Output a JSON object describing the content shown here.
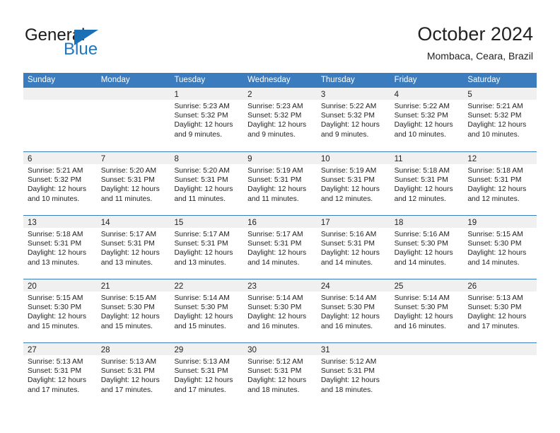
{
  "brand": {
    "name_part1": "General",
    "name_part2": "Blue",
    "accent_color": "#2077c0",
    "triangle_color": "#1a6fb5"
  },
  "header": {
    "title": "October 2024",
    "subtitle": "Mombaca, Ceara, Brazil"
  },
  "calendar": {
    "header_bg": "#3a7cbe",
    "day_band_bg": "#f0f0f0",
    "weekdays": [
      "Sunday",
      "Monday",
      "Tuesday",
      "Wednesday",
      "Thursday",
      "Friday",
      "Saturday"
    ],
    "weeks": [
      [
        {
          "day": "",
          "lines": []
        },
        {
          "day": "",
          "lines": []
        },
        {
          "day": "1",
          "lines": [
            "Sunrise: 5:23 AM",
            "Sunset: 5:32 PM",
            "Daylight: 12 hours and 9 minutes."
          ]
        },
        {
          "day": "2",
          "lines": [
            "Sunrise: 5:23 AM",
            "Sunset: 5:32 PM",
            "Daylight: 12 hours and 9 minutes."
          ]
        },
        {
          "day": "3",
          "lines": [
            "Sunrise: 5:22 AM",
            "Sunset: 5:32 PM",
            "Daylight: 12 hours and 9 minutes."
          ]
        },
        {
          "day": "4",
          "lines": [
            "Sunrise: 5:22 AM",
            "Sunset: 5:32 PM",
            "Daylight: 12 hours and 10 minutes."
          ]
        },
        {
          "day": "5",
          "lines": [
            "Sunrise: 5:21 AM",
            "Sunset: 5:32 PM",
            "Daylight: 12 hours and 10 minutes."
          ]
        }
      ],
      [
        {
          "day": "6",
          "lines": [
            "Sunrise: 5:21 AM",
            "Sunset: 5:32 PM",
            "Daylight: 12 hours and 10 minutes."
          ]
        },
        {
          "day": "7",
          "lines": [
            "Sunrise: 5:20 AM",
            "Sunset: 5:31 PM",
            "Daylight: 12 hours and 11 minutes."
          ]
        },
        {
          "day": "8",
          "lines": [
            "Sunrise: 5:20 AM",
            "Sunset: 5:31 PM",
            "Daylight: 12 hours and 11 minutes."
          ]
        },
        {
          "day": "9",
          "lines": [
            "Sunrise: 5:19 AM",
            "Sunset: 5:31 PM",
            "Daylight: 12 hours and 11 minutes."
          ]
        },
        {
          "day": "10",
          "lines": [
            "Sunrise: 5:19 AM",
            "Sunset: 5:31 PM",
            "Daylight: 12 hours and 12 minutes."
          ]
        },
        {
          "day": "11",
          "lines": [
            "Sunrise: 5:18 AM",
            "Sunset: 5:31 PM",
            "Daylight: 12 hours and 12 minutes."
          ]
        },
        {
          "day": "12",
          "lines": [
            "Sunrise: 5:18 AM",
            "Sunset: 5:31 PM",
            "Daylight: 12 hours and 12 minutes."
          ]
        }
      ],
      [
        {
          "day": "13",
          "lines": [
            "Sunrise: 5:18 AM",
            "Sunset: 5:31 PM",
            "Daylight: 12 hours and 13 minutes."
          ]
        },
        {
          "day": "14",
          "lines": [
            "Sunrise: 5:17 AM",
            "Sunset: 5:31 PM",
            "Daylight: 12 hours and 13 minutes."
          ]
        },
        {
          "day": "15",
          "lines": [
            "Sunrise: 5:17 AM",
            "Sunset: 5:31 PM",
            "Daylight: 12 hours and 13 minutes."
          ]
        },
        {
          "day": "16",
          "lines": [
            "Sunrise: 5:17 AM",
            "Sunset: 5:31 PM",
            "Daylight: 12 hours and 14 minutes."
          ]
        },
        {
          "day": "17",
          "lines": [
            "Sunrise: 5:16 AM",
            "Sunset: 5:31 PM",
            "Daylight: 12 hours and 14 minutes."
          ]
        },
        {
          "day": "18",
          "lines": [
            "Sunrise: 5:16 AM",
            "Sunset: 5:30 PM",
            "Daylight: 12 hours and 14 minutes."
          ]
        },
        {
          "day": "19",
          "lines": [
            "Sunrise: 5:15 AM",
            "Sunset: 5:30 PM",
            "Daylight: 12 hours and 14 minutes."
          ]
        }
      ],
      [
        {
          "day": "20",
          "lines": [
            "Sunrise: 5:15 AM",
            "Sunset: 5:30 PM",
            "Daylight: 12 hours and 15 minutes."
          ]
        },
        {
          "day": "21",
          "lines": [
            "Sunrise: 5:15 AM",
            "Sunset: 5:30 PM",
            "Daylight: 12 hours and 15 minutes."
          ]
        },
        {
          "day": "22",
          "lines": [
            "Sunrise: 5:14 AM",
            "Sunset: 5:30 PM",
            "Daylight: 12 hours and 15 minutes."
          ]
        },
        {
          "day": "23",
          "lines": [
            "Sunrise: 5:14 AM",
            "Sunset: 5:30 PM",
            "Daylight: 12 hours and 16 minutes."
          ]
        },
        {
          "day": "24",
          "lines": [
            "Sunrise: 5:14 AM",
            "Sunset: 5:30 PM",
            "Daylight: 12 hours and 16 minutes."
          ]
        },
        {
          "day": "25",
          "lines": [
            "Sunrise: 5:14 AM",
            "Sunset: 5:30 PM",
            "Daylight: 12 hours and 16 minutes."
          ]
        },
        {
          "day": "26",
          "lines": [
            "Sunrise: 5:13 AM",
            "Sunset: 5:30 PM",
            "Daylight: 12 hours and 17 minutes."
          ]
        }
      ],
      [
        {
          "day": "27",
          "lines": [
            "Sunrise: 5:13 AM",
            "Sunset: 5:31 PM",
            "Daylight: 12 hours and 17 minutes."
          ]
        },
        {
          "day": "28",
          "lines": [
            "Sunrise: 5:13 AM",
            "Sunset: 5:31 PM",
            "Daylight: 12 hours and 17 minutes."
          ]
        },
        {
          "day": "29",
          "lines": [
            "Sunrise: 5:13 AM",
            "Sunset: 5:31 PM",
            "Daylight: 12 hours and 17 minutes."
          ]
        },
        {
          "day": "30",
          "lines": [
            "Sunrise: 5:12 AM",
            "Sunset: 5:31 PM",
            "Daylight: 12 hours and 18 minutes."
          ]
        },
        {
          "day": "31",
          "lines": [
            "Sunrise: 5:12 AM",
            "Sunset: 5:31 PM",
            "Daylight: 12 hours and 18 minutes."
          ]
        },
        {
          "day": "",
          "lines": []
        },
        {
          "day": "",
          "lines": []
        }
      ]
    ]
  }
}
